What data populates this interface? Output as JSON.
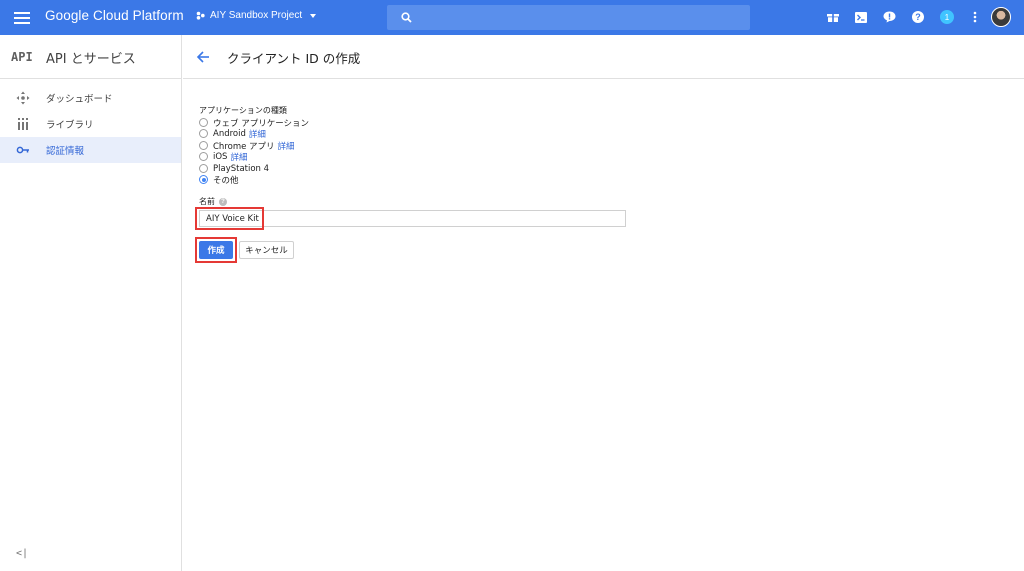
{
  "topbar": {
    "product_name": "Google Cloud Platform",
    "project_name": "AIY Sandbox Project",
    "notification_count": "1"
  },
  "sidebar": {
    "logo": "API",
    "title": "API とサービス",
    "items": [
      {
        "label": "ダッシュボード",
        "icon": "dashboard-icon"
      },
      {
        "label": "ライブラリ",
        "icon": "library-icon"
      },
      {
        "label": "認証情報",
        "icon": "key-icon",
        "active": true
      }
    ],
    "collapse": "<|"
  },
  "page": {
    "title": "クライアント ID の作成"
  },
  "form": {
    "app_type_label": "アプリケーションの種類",
    "options": [
      {
        "label": "ウェブ アプリケーション",
        "link": ""
      },
      {
        "label": "Android",
        "link": "詳細"
      },
      {
        "label": "Chrome アプリ",
        "link": "詳細"
      },
      {
        "label": "iOS",
        "link": "詳細"
      },
      {
        "label": "PlayStation 4",
        "link": ""
      },
      {
        "label": "その他",
        "link": "",
        "selected": true
      }
    ],
    "name_label": "名前",
    "name_value": "AIY Voice Kit",
    "create_label": "作成",
    "cancel_label": "キャンセル"
  },
  "colors": {
    "topbar": "#3b78e7",
    "accent": "#3367d6",
    "highlight": "#e53935",
    "active_nav_bg": "#e8eefb"
  }
}
